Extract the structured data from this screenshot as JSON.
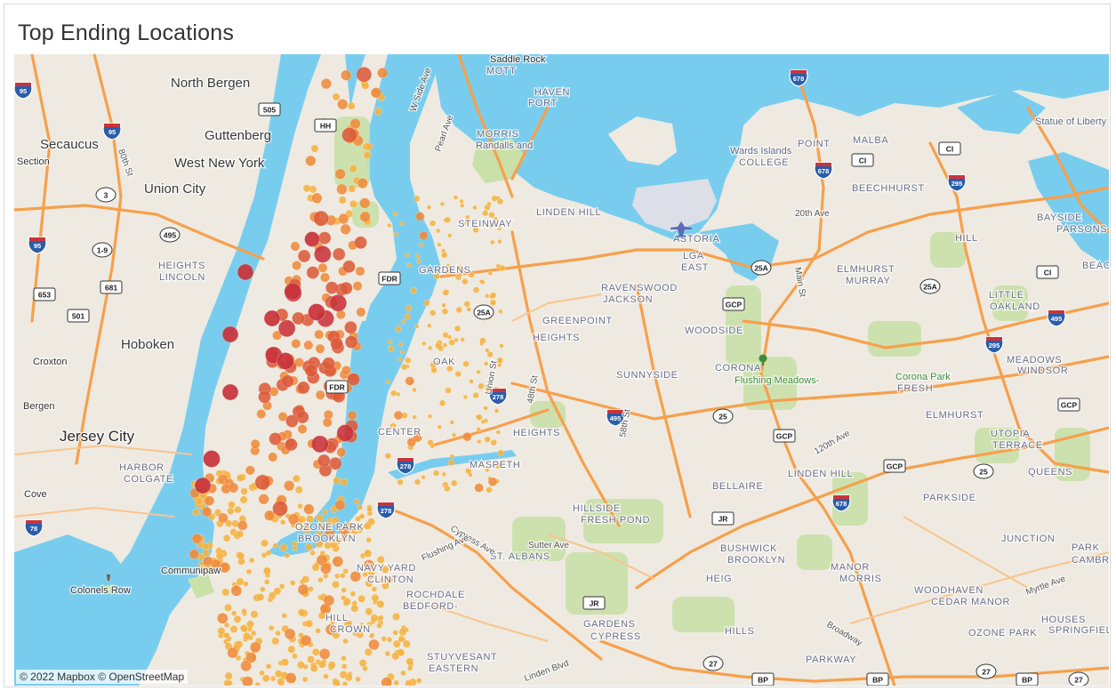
{
  "title": "Top Ending Locations",
  "attribution": "© 2022 Mapbox © OpenStreetMap",
  "colors": {
    "water": "#78cdee",
    "land": "#eeeae1",
    "park": "#c9e0a9",
    "highway": "#f6a04d",
    "dot_small": "#f5b240",
    "dot_mid": "#ef8a3b",
    "dot_large": "#dc5a3a",
    "dot_top": "#c8323a"
  },
  "place_labels": [
    {
      "text": "North Bergen",
      "cls": "city"
    },
    {
      "text": "Guttenberg",
      "cls": "city"
    },
    {
      "text": "West New York",
      "cls": "city"
    },
    {
      "text": "Union City",
      "cls": "city"
    },
    {
      "text": "Secaucus",
      "cls": "city"
    },
    {
      "text": "Hoboken",
      "cls": "city"
    },
    {
      "text": "Jersey City",
      "cls": "bigcity"
    },
    {
      "text": "Bergen",
      "cls": "small"
    },
    {
      "text": "Croxton",
      "cls": "small"
    },
    {
      "text": "Section",
      "cls": "small"
    },
    {
      "text": "Cove",
      "cls": "small"
    },
    {
      "text": "Communipaw",
      "cls": "small"
    },
    {
      "text": "Colonels Row",
      "cls": "small"
    },
    {
      "text": "Statue of Liberty",
      "cls": "poi"
    },
    {
      "text": "Saddle Rock",
      "cls": "small"
    },
    {
      "text": "MOTT",
      "cls": "hood"
    },
    {
      "text": "HAVEN",
      "cls": "hood"
    },
    {
      "text": "PORT",
      "cls": "hood"
    },
    {
      "text": "MORRIS",
      "cls": "hood"
    },
    {
      "text": "Randalls and",
      "cls": "poi"
    },
    {
      "text": "Wards Islands",
      "cls": "poi"
    },
    {
      "text": "COLLEGE",
      "cls": "hood"
    },
    {
      "text": "POINT",
      "cls": "hood"
    },
    {
      "text": "MALBA",
      "cls": "hood"
    },
    {
      "text": "BEECHHURST",
      "cls": "hood"
    },
    {
      "text": "20th Ave",
      "cls": "street"
    },
    {
      "text": "LINDEN HILL",
      "cls": "hood"
    },
    {
      "text": "STEINWAY",
      "cls": "hood"
    },
    {
      "text": "ASTORIA",
      "cls": "hood"
    },
    {
      "text": "LGA",
      "cls": "hood"
    },
    {
      "text": "EAST",
      "cls": "hood"
    },
    {
      "text": "ELMHURST",
      "cls": "hood"
    },
    {
      "text": "MURRAY",
      "cls": "hood"
    },
    {
      "text": "HILL",
      "cls": "hood"
    },
    {
      "text": "BAYSIDE",
      "cls": "hood"
    },
    {
      "text": "PARSONS",
      "cls": "hood"
    },
    {
      "text": "BEACH",
      "cls": "hood"
    },
    {
      "text": "LITTLE",
      "cls": "hood"
    },
    {
      "text": "OAKLAND",
      "cls": "hood"
    },
    {
      "text": "GARDENS",
      "cls": "hood"
    },
    {
      "text": "RAVENSWOOD",
      "cls": "hood"
    },
    {
      "text": "JACKSON",
      "cls": "hood"
    },
    {
      "text": "HEIGHTS",
      "cls": "hood"
    },
    {
      "text": "WOODSIDE",
      "cls": "hood"
    },
    {
      "text": "CORONA",
      "cls": "hood"
    },
    {
      "text": "Flushing Meadows-",
      "cls": "park"
    },
    {
      "text": "Corona Park",
      "cls": "park"
    },
    {
      "text": "FRESH",
      "cls": "hood"
    },
    {
      "text": "MEADOWS",
      "cls": "hood"
    },
    {
      "text": "WINDSOR",
      "cls": "hood"
    },
    {
      "text": "OAK",
      "cls": "hood"
    },
    {
      "text": "SUNNYSIDE",
      "cls": "hood"
    },
    {
      "text": "ELMHURST",
      "cls": "hood"
    },
    {
      "text": "UTOPIA",
      "cls": "hood"
    },
    {
      "text": "TERRACE",
      "cls": "hood"
    },
    {
      "text": "HEIGHTS",
      "cls": "hood"
    },
    {
      "text": "MASPETH",
      "cls": "hood"
    },
    {
      "text": "LINDEN HILL",
      "cls": "hood"
    },
    {
      "text": "QUEENS",
      "cls": "hood"
    },
    {
      "text": "BELLAIRE",
      "cls": "hood"
    },
    {
      "text": "PARKSIDE",
      "cls": "hood"
    },
    {
      "text": "HILLSIDE",
      "cls": "hood"
    },
    {
      "text": "FRESH POND",
      "cls": "hood"
    },
    {
      "text": "JUNCTION",
      "cls": "hood"
    },
    {
      "text": "ST. ALBANS",
      "cls": "hood"
    },
    {
      "text": "BUSHWICK",
      "cls": "hood"
    },
    {
      "text": "BROOKLYN",
      "cls": "hood"
    },
    {
      "text": "MANOR",
      "cls": "hood"
    },
    {
      "text": "MORRIS",
      "cls": "hood"
    },
    {
      "text": "PARK",
      "cls": "hood"
    },
    {
      "text": "CAMBR",
      "cls": "hood"
    },
    {
      "text": "HEIG",
      "cls": "hood"
    },
    {
      "text": "WOODHAVEN",
      "cls": "hood"
    },
    {
      "text": "CEDAR MANOR",
      "cls": "hood"
    },
    {
      "text": "HOUSES",
      "cls": "hood"
    },
    {
      "text": "SPRINGFIELD",
      "cls": "hood"
    },
    {
      "text": "GARDENS",
      "cls": "hood"
    },
    {
      "text": "CYPRESS",
      "cls": "hood"
    },
    {
      "text": "HILLS",
      "cls": "hood"
    },
    {
      "text": "OZONE PARK",
      "cls": "hood"
    },
    {
      "text": "ROCHDALE",
      "cls": "hood"
    },
    {
      "text": "BEDFORD-",
      "cls": "hood"
    },
    {
      "text": "STUYVESANT",
      "cls": "hood"
    },
    {
      "text": "EASTERN",
      "cls": "hood"
    },
    {
      "text": "PARKWAY",
      "cls": "hood"
    },
    {
      "text": "OZONE PARK",
      "cls": "hood"
    },
    {
      "text": "BROOKLYN",
      "cls": "hood"
    },
    {
      "text": "NAVY YARD",
      "cls": "hood"
    },
    {
      "text": "CLINTON",
      "cls": "hood"
    },
    {
      "text": "HILL",
      "cls": "hood"
    },
    {
      "text": "CROWN",
      "cls": "hood"
    },
    {
      "text": "HEIGHTS",
      "cls": "hood"
    },
    {
      "text": "LINCOLN",
      "cls": "hood"
    },
    {
      "text": "HARBOR",
      "cls": "hood"
    },
    {
      "text": "COLGATE",
      "cls": "hood"
    },
    {
      "text": "CENTER",
      "cls": "hood"
    },
    {
      "text": "GREENPOINT",
      "cls": "hood"
    },
    {
      "text": "Broadway",
      "cls": "street"
    },
    {
      "text": "Linden Blvd",
      "cls": "street"
    },
    {
      "text": "Sutter Ave",
      "cls": "street"
    },
    {
      "text": "Cypress Ave",
      "cls": "street"
    },
    {
      "text": "Flushing Ave",
      "cls": "street"
    },
    {
      "text": "Myrtle Ave",
      "cls": "street"
    },
    {
      "text": "120th Ave",
      "cls": "street"
    },
    {
      "text": "Main St",
      "cls": "street"
    },
    {
      "text": "Union St",
      "cls": "street"
    },
    {
      "text": "48th St",
      "cls": "street"
    },
    {
      "text": "58th St",
      "cls": "street"
    },
    {
      "text": "80th St",
      "cls": "street"
    },
    {
      "text": "W Side Ave",
      "cls": "street"
    },
    {
      "text": "Pearl Ave",
      "cls": "street"
    },
    {
      "text": "FDR Dr",
      "cls": "street"
    }
  ],
  "shields": [
    {
      "text": "95",
      "kind": "interstate"
    },
    {
      "text": "95",
      "kind": "interstate"
    },
    {
      "text": "95",
      "kind": "interstate"
    },
    {
      "text": "678",
      "kind": "interstate"
    },
    {
      "text": "678",
      "kind": "interstate"
    },
    {
      "text": "678",
      "kind": "interstate"
    },
    {
      "text": "678",
      "kind": "interstate"
    },
    {
      "text": "295",
      "kind": "interstate"
    },
    {
      "text": "295",
      "kind": "interstate"
    },
    {
      "text": "495",
      "kind": "interstate"
    },
    {
      "text": "495",
      "kind": "interstate"
    },
    {
      "text": "278",
      "kind": "interstate"
    },
    {
      "text": "278",
      "kind": "interstate"
    },
    {
      "text": "278",
      "kind": "interstate"
    },
    {
      "text": "78",
      "kind": "interstate"
    },
    {
      "text": "505",
      "kind": "box"
    },
    {
      "text": "495",
      "kind": "oval"
    },
    {
      "text": "681",
      "kind": "box"
    },
    {
      "text": "653",
      "kind": "box"
    },
    {
      "text": "501",
      "kind": "box"
    },
    {
      "text": "1-9",
      "kind": "oval"
    },
    {
      "text": "3",
      "kind": "oval"
    },
    {
      "text": "HH",
      "kind": "box"
    },
    {
      "text": "FDR",
      "kind": "box"
    },
    {
      "text": "FDR",
      "kind": "box"
    },
    {
      "text": "CI",
      "kind": "box"
    },
    {
      "text": "CI",
      "kind": "box"
    },
    {
      "text": "CI",
      "kind": "box"
    },
    {
      "text": "GCP",
      "kind": "box"
    },
    {
      "text": "GCP",
      "kind": "box"
    },
    {
      "text": "GCP",
      "kind": "box"
    },
    {
      "text": "GCP",
      "kind": "box"
    },
    {
      "text": "25A",
      "kind": "oval"
    },
    {
      "text": "25A",
      "kind": "oval"
    },
    {
      "text": "25A",
      "kind": "oval"
    },
    {
      "text": "25",
      "kind": "oval"
    },
    {
      "text": "25",
      "kind": "oval"
    },
    {
      "text": "JR",
      "kind": "box"
    },
    {
      "text": "JR",
      "kind": "box"
    },
    {
      "text": "27",
      "kind": "oval"
    },
    {
      "text": "27",
      "kind": "oval"
    },
    {
      "text": "27",
      "kind": "oval"
    },
    {
      "text": "BP",
      "kind": "box"
    },
    {
      "text": "BP",
      "kind": "box"
    },
    {
      "text": "BP",
      "kind": "box"
    }
  ]
}
